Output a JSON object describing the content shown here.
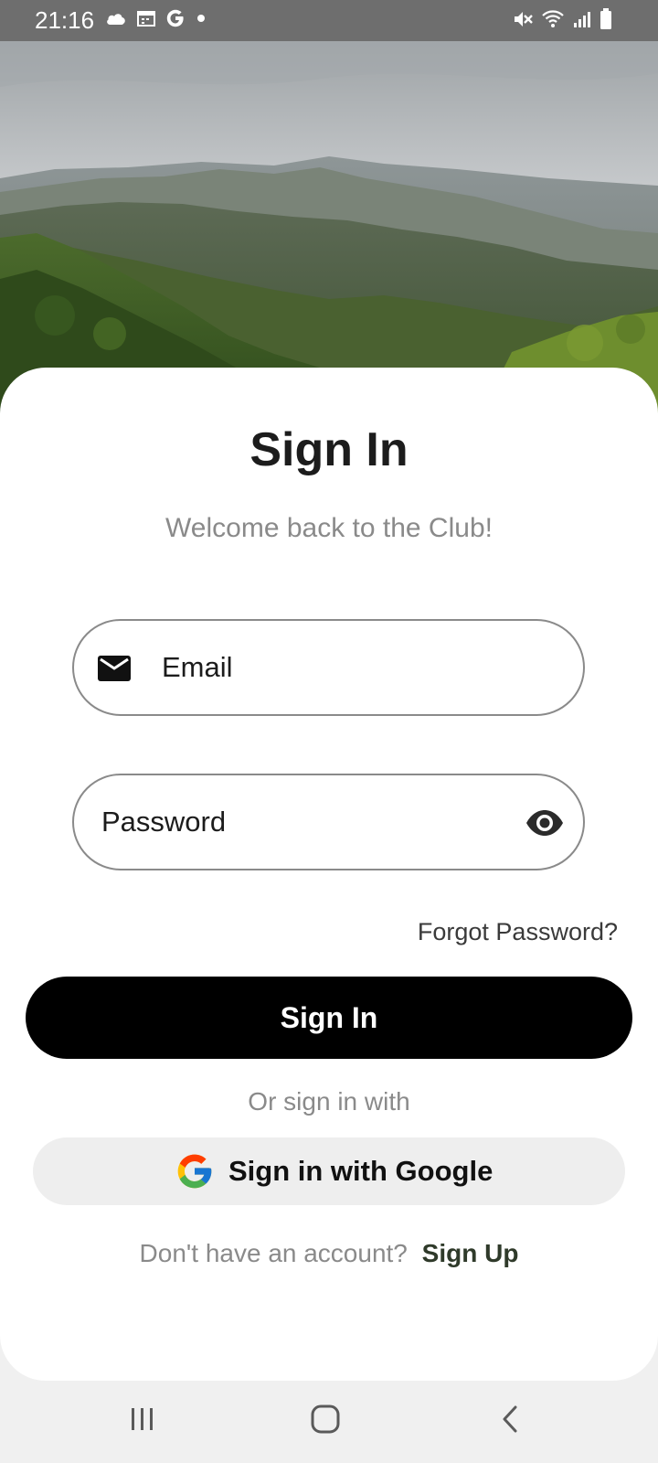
{
  "status_bar": {
    "time": "21:16",
    "left_icons": [
      "cloud-icon",
      "calendar-icon",
      "google-g-icon",
      "dot-icon"
    ],
    "right_icons": [
      "mute-icon",
      "wifi-icon",
      "signal-icon",
      "battery-icon"
    ]
  },
  "hero": {
    "image": "mountain-landscape"
  },
  "signin": {
    "title": "Sign In",
    "subtitle": "Welcome back to the Club!",
    "email_placeholder": "Email",
    "password_placeholder": "Password",
    "forgot_password": "Forgot Password?",
    "signin_button": "Sign In",
    "or_text": "Or sign in with",
    "google_button": "Sign in with Google",
    "signup_prompt": "Don't have an account?",
    "signup_link": "Sign Up"
  },
  "nav_bar": {
    "icons": [
      "recent-apps-icon",
      "home-icon",
      "back-icon"
    ]
  },
  "colors": {
    "status_bar": "#6e6e6e",
    "primary_button": "#000000",
    "google_button_bg": "#eeeeee",
    "muted_text": "#8a8a8a",
    "link_text": "#2f3a2a"
  }
}
